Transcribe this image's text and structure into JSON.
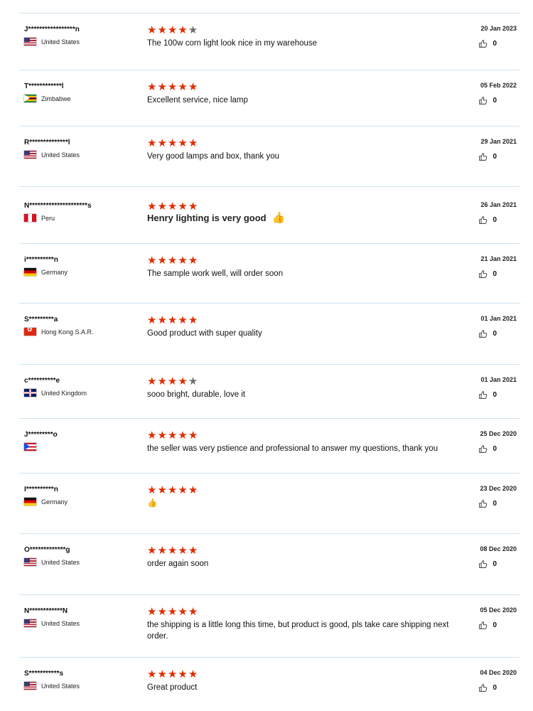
{
  "reviews": [
    {
      "name": "J*****************n",
      "country": "United States",
      "flag": "us",
      "stars": 4,
      "comment": "The 100w corn light look nice in my warehouse",
      "date": "20 Jan 2023",
      "likes": "0"
    },
    {
      "name": "T************l",
      "country": "Zimbabwe",
      "flag": "zw",
      "stars": 5,
      "comment": "Excellent service, nice lamp",
      "date": "05 Feb 2022",
      "likes": "0"
    },
    {
      "name": "R**************l",
      "country": "United States",
      "flag": "us",
      "stars": 5,
      "comment": "Very good lamps and box, thank you",
      "date": "29 Jan 2021",
      "likes": "0"
    },
    {
      "name": "N*********************s",
      "country": "Peru",
      "flag": "pe",
      "stars": 5,
      "comment": "Henry lighting is very good",
      "emoji": "👍",
      "date": "26 Jan 2021",
      "likes": "0"
    },
    {
      "name": "i**********n",
      "country": "Germany",
      "flag": "de",
      "stars": 5,
      "comment": "The sample work well, will order soon",
      "date": "21 Jan 2021",
      "likes": "0"
    },
    {
      "name": "S*********a",
      "country": "Hong Kong S.A.R.",
      "flag": "hk",
      "stars": 5,
      "comment": "Good product with super quality",
      "date": "01 Jan 2021",
      "likes": "0"
    },
    {
      "name": "c**********e",
      "country": "United Kingdom",
      "flag": "uk",
      "stars": 4,
      "comment": "sooo bright, durable, love it",
      "date": "01 Jan 2021",
      "likes": "0"
    },
    {
      "name": "J*********o",
      "country": "",
      "flag": "pr",
      "stars": 5,
      "comment": "the seller was very pstience and professional to answer my questions, thank you",
      "date": "25 Dec 2020",
      "likes": "0"
    },
    {
      "name": "I**********n",
      "country": "Germany",
      "flag": "de",
      "stars": 5,
      "comment": "👍",
      "date": "23 Dec 2020",
      "likes": "0"
    },
    {
      "name": "O*************g",
      "country": "United States",
      "flag": "us",
      "stars": 5,
      "comment": "order again soon",
      "date": "08 Dec 2020",
      "likes": "0"
    },
    {
      "name": "N************N",
      "country": "United States",
      "flag": "us",
      "stars": 5,
      "comment": "the shipping is a little long this time, but product is good, pls take care shipping next order.",
      "date": "05 Dec 2020",
      "likes": "0"
    },
    {
      "name": "S***********s",
      "country": "United States",
      "flag": "us",
      "stars": 5,
      "comment": "Great product",
      "date": "04 Dec 2020",
      "likes": "0"
    }
  ],
  "colors": {
    "star_filled": "#e02c00",
    "star_empty": "#6d6d74",
    "divider": "#cfe3f0"
  },
  "icons": {
    "like": "thumbs-up-outline-icon",
    "star": "star-icon"
  }
}
